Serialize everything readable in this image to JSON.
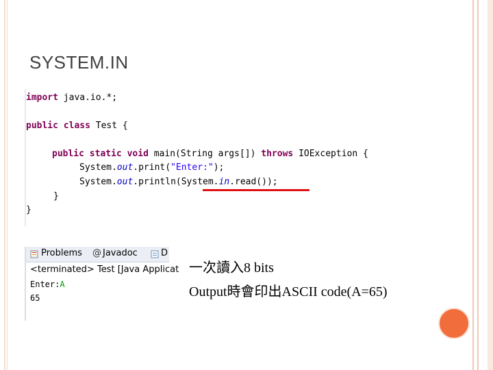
{
  "slide": {
    "title": "SYSTEM.IN"
  },
  "code": {
    "line1": {
      "kw": "import",
      "rest": " java.io.*;"
    },
    "line2": {
      "kw1": "public",
      "kw2": "class",
      "rest": " Test {"
    },
    "line3": {
      "kw1": "public",
      "kw2": "static",
      "kw3": "void",
      "sig": " main(String args[]) ",
      "kw4": "throws",
      "tail": " IOException {"
    },
    "line4": {
      "pre": "System.",
      "field": "out",
      "mid": ".print(",
      "str": "\"Enter:\"",
      "post": ");"
    },
    "line5": {
      "pre": "System.",
      "field": "out",
      "mid": ".println(System.",
      "field2": "in",
      "post": ".read());"
    },
    "line6": "}",
    "line7": "}"
  },
  "console": {
    "tabs": [
      {
        "label": "Problems",
        "icon": "problems-icon"
      },
      {
        "label": "Javadoc",
        "icon": "javadoc-icon"
      },
      {
        "label": "D",
        "icon": "declaration-icon"
      }
    ],
    "javadoc_prefix": "@",
    "status": "<terminated> Test [Java Applicat",
    "prompt": "Enter:",
    "input": "A",
    "output": "65"
  },
  "note": {
    "line1": "一次讀入8 bits",
    "line2": "Output時會印出ASCII code(A=65)"
  },
  "colors": {
    "keyword": "#7f0055",
    "string": "#2a00ff",
    "field": "#0000c0",
    "underline": "#e01010",
    "accent_dot": "#f26d3c",
    "title_text": "#404040"
  }
}
